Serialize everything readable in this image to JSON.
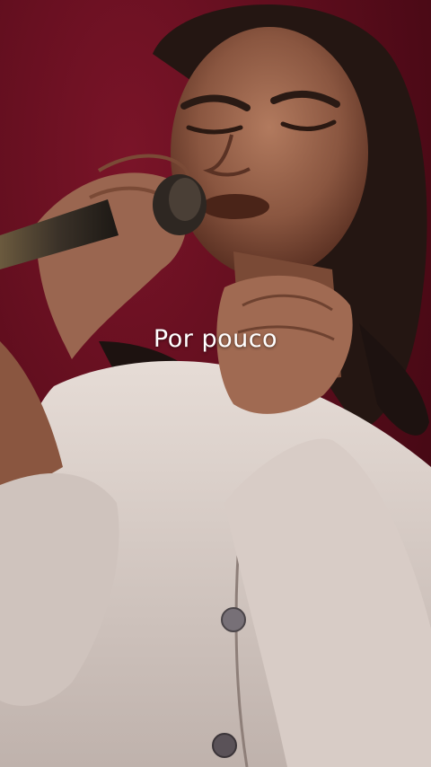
{
  "video": {
    "caption": "Por pouco"
  },
  "colors": {
    "background": "#5c0d1c",
    "caption_text": "#ffffff"
  }
}
